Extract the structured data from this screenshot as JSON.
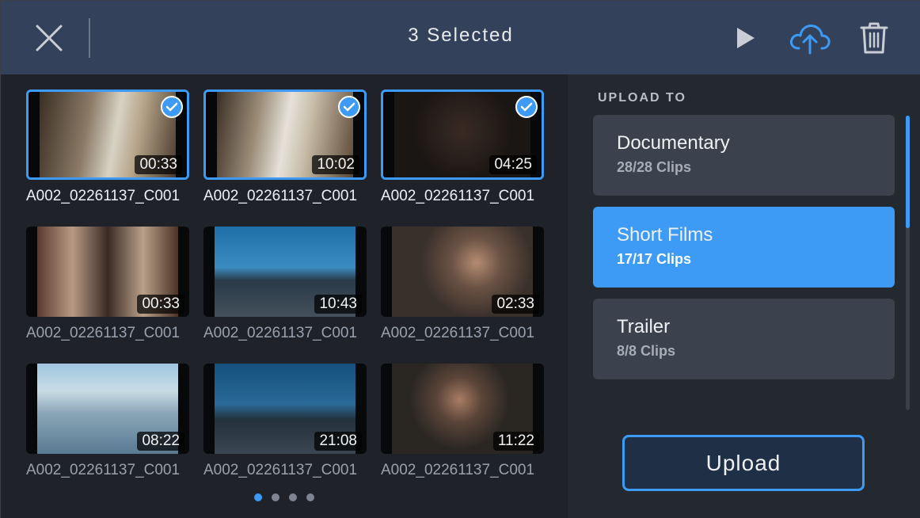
{
  "header": {
    "title": "3 Selected",
    "icons": {
      "close": "close-icon",
      "play": "play-icon",
      "upload": "cloud-upload-icon",
      "delete": "trash-icon"
    }
  },
  "clips": [
    {
      "name": "A002_02261137_C001",
      "duration": "00:33",
      "selected": true
    },
    {
      "name": "A002_02261137_C001",
      "duration": "10:02",
      "selected": true
    },
    {
      "name": "A002_02261137_C001",
      "duration": "04:25",
      "selected": true
    },
    {
      "name": "A002_02261137_C001",
      "duration": "00:33",
      "selected": false
    },
    {
      "name": "A002_02261137_C001",
      "duration": "10:43",
      "selected": false
    },
    {
      "name": "A002_02261137_C001",
      "duration": "02:33",
      "selected": false
    },
    {
      "name": "A002_02261137_C001",
      "duration": "08:22",
      "selected": false
    },
    {
      "name": "A002_02261137_C001",
      "duration": "21:08",
      "selected": false
    },
    {
      "name": "A002_02261137_C001",
      "duration": "11:22",
      "selected": false
    }
  ],
  "pagination": {
    "pages": 4,
    "current": 1
  },
  "upload_panel": {
    "heading": "UPLOAD TO",
    "destinations": [
      {
        "title": "Documentary",
        "clips": "28/28 Clips",
        "active": false
      },
      {
        "title": "Short Films",
        "clips": "17/17 Clips",
        "active": true
      },
      {
        "title": "Trailer",
        "clips": "8/8 Clips",
        "active": false
      }
    ],
    "upload_label": "Upload"
  },
  "colors": {
    "accent": "#3d9bf5",
    "topbar": "#33425a",
    "background": "#1f2329",
    "card": "#3c424d"
  }
}
